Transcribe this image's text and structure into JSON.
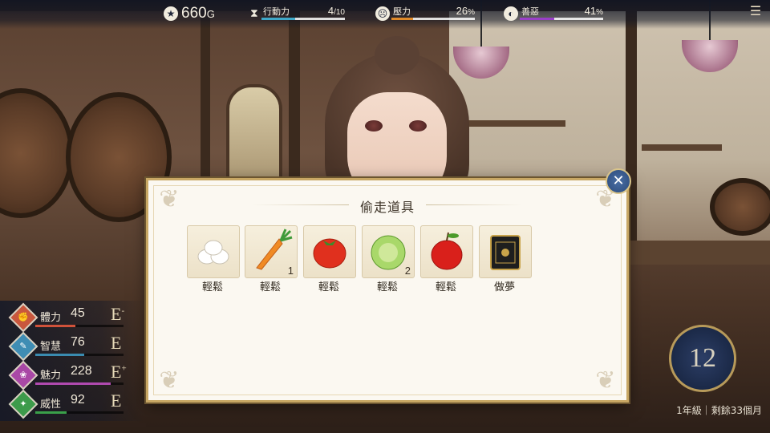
{
  "hud": {
    "gold": {
      "icon": "coin-icon",
      "value": "660",
      "unit": "G"
    },
    "action": {
      "icon": "hourglass-icon",
      "label": "行動力",
      "current": "4",
      "max": "/10",
      "fraction": 0.4,
      "color": "#3fa8c8"
    },
    "stress": {
      "icon": "stress-face-icon",
      "label": "壓力",
      "value": "26",
      "unit": "%",
      "fraction": 0.26,
      "color": "#e08a2a"
    },
    "morality": {
      "icon": "morality-icon",
      "label": "善惡",
      "value": "41",
      "unit": "%",
      "fraction": 0.41,
      "color": "#9a3fc8"
    },
    "menu_icon": "menu-icon"
  },
  "stats": [
    {
      "name": "體力",
      "value": "45",
      "grade": "E",
      "sup": "-",
      "fraction": 0.45,
      "color": "#d0523a",
      "icon_color": "#c9573d"
    },
    {
      "name": "智慧",
      "value": "76",
      "grade": "E",
      "sup": "",
      "fraction": 0.55,
      "color": "#3a8bb0",
      "icon_color": "#3f8db4"
    },
    {
      "name": "魅力",
      "value": "228",
      "grade": "E",
      "sup": "+",
      "fraction": 0.85,
      "color": "#b04ab0",
      "icon_color": "#a948a6"
    },
    {
      "name": "威性",
      "value": "92",
      "grade": "E",
      "sup": "",
      "fraction": 0.35,
      "color": "#3aa04a",
      "icon_color": "#3d9b4b"
    }
  ],
  "dialog": {
    "title": "偷走道具",
    "items": [
      {
        "name": "eggs",
        "label": "輕鬆",
        "qty": ""
      },
      {
        "name": "carrot",
        "label": "輕鬆",
        "qty": "1"
      },
      {
        "name": "tomato",
        "label": "輕鬆",
        "qty": ""
      },
      {
        "name": "cabbage",
        "label": "輕鬆",
        "qty": "2"
      },
      {
        "name": "apple",
        "label": "輕鬆",
        "qty": ""
      },
      {
        "name": "safe",
        "label": "做夢",
        "qty": ""
      }
    ],
    "close_icon": "close-icon"
  },
  "calendar": {
    "day": "12",
    "text": "1年級｜剩餘33個月"
  }
}
